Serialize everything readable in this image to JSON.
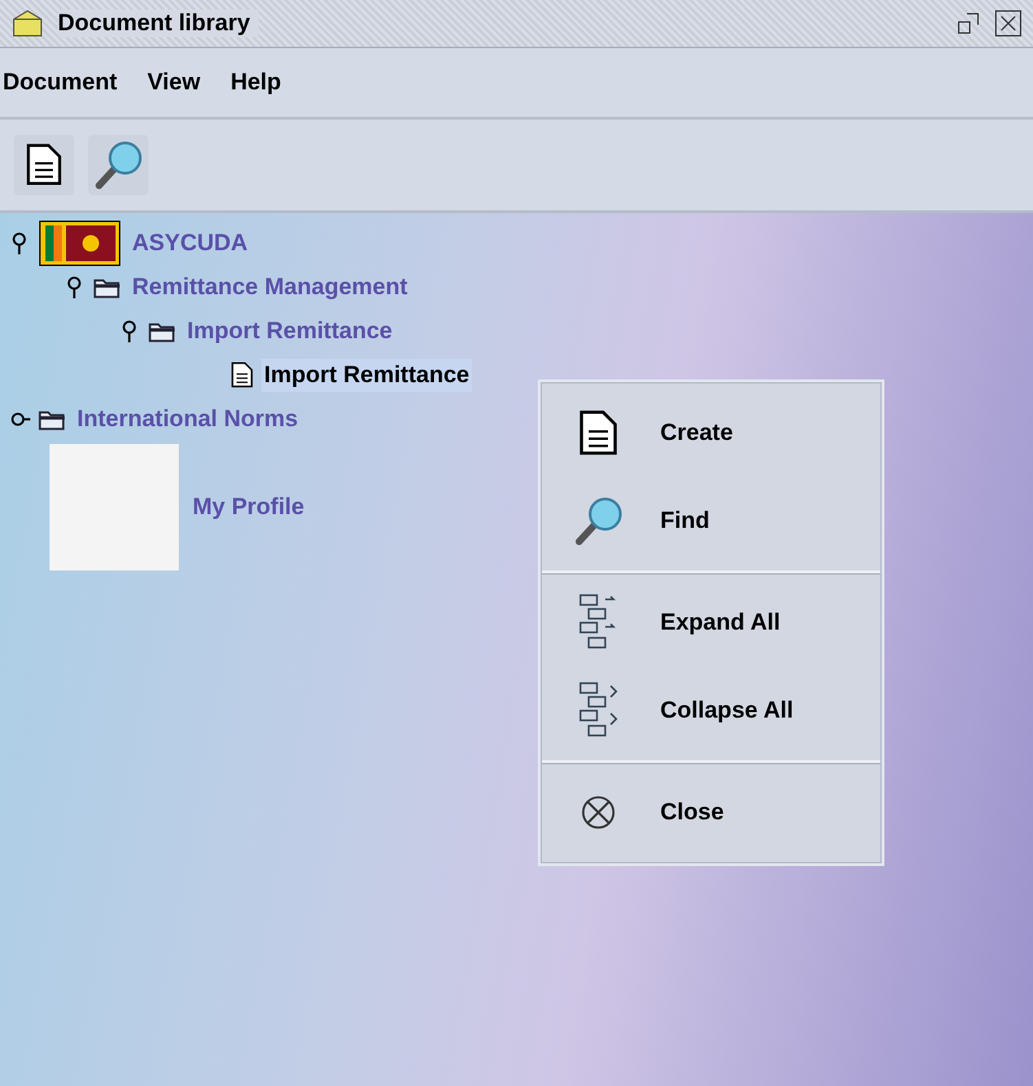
{
  "window": {
    "title": "Document library"
  },
  "menu": [
    "Document",
    "View",
    "Help"
  ],
  "tree": [
    {
      "kind": "root",
      "label": "ASYCUDA",
      "expanded": true,
      "selected": false,
      "children": [
        {
          "kind": "folder",
          "label": "Remittance Management",
          "expanded": true,
          "selected": false,
          "children": [
            {
              "kind": "folder",
              "label": "Import Remittance",
              "expanded": true,
              "selected": false,
              "children": [
                {
                  "kind": "document",
                  "label": "Import Remittance",
                  "selected": true
                }
              ]
            }
          ]
        }
      ]
    },
    {
      "kind": "folder",
      "label": "International Norms",
      "expanded": false,
      "selected": false
    },
    {
      "kind": "profile",
      "label": "My Profile",
      "selected": false
    }
  ],
  "context_menu": [
    [
      {
        "kind": "create",
        "label": "Create"
      },
      {
        "kind": "find",
        "label": "Find"
      }
    ],
    [
      {
        "kind": "expand",
        "label": "Expand All"
      },
      {
        "kind": "collapse",
        "label": "Collapse All"
      }
    ],
    [
      {
        "kind": "close",
        "label": "Close"
      }
    ]
  ]
}
